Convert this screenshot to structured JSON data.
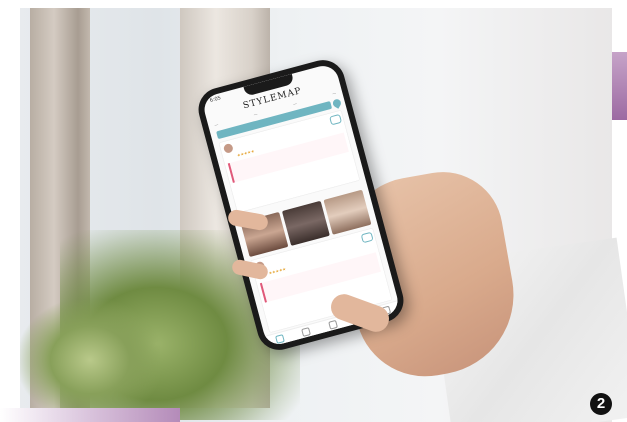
{
  "photo": {
    "description_alt": "",
    "badge_number": "2"
  },
  "phone_app": {
    "title": "STYLEMAP",
    "status_time": "6:05",
    "tabs": [
      "",
      "",
      "",
      ""
    ],
    "filter_label": "",
    "card1": {
      "name": "",
      "rating": "★★★★★",
      "coupon_title": "",
      "coupon_price": "",
      "coupon_link": ""
    },
    "section_label": "",
    "card2": {
      "name": "",
      "rating": "★★★★★",
      "coupon_title": "",
      "coupon_price": "",
      "coupon_link": ""
    }
  },
  "colors": {
    "accent": "#6fb5c1",
    "coupon_accent": "#e05a7a",
    "badge": "#111111"
  }
}
